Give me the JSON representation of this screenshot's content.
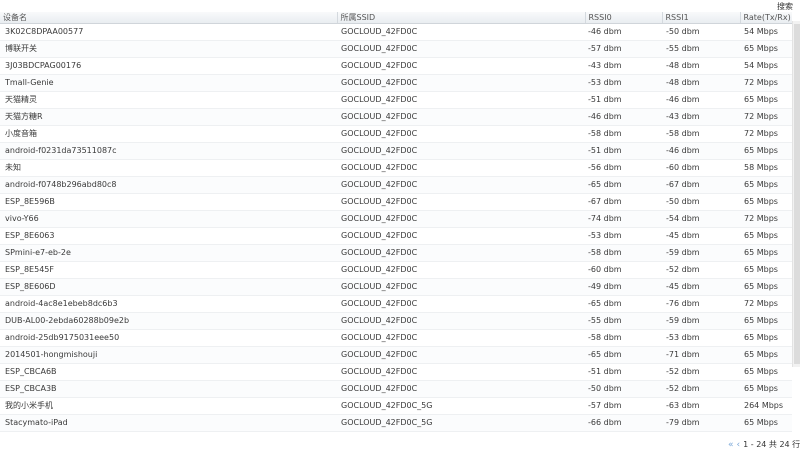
{
  "toolbar": {
    "search_label": "搜索"
  },
  "table": {
    "headers": {
      "device_name": "设备名",
      "ssid": "所属SSID",
      "rssi0": "RSSI0",
      "rssi1": "RSSI1",
      "rate": "Rate(Tx/Rx)"
    },
    "rows": [
      {
        "name": "3K02C8DPAA00577",
        "ssid": "GOCLOUD_42FD0C",
        "rssi0": "-46 dbm",
        "rssi1": "-50 dbm",
        "rate": "54 Mbps"
      },
      {
        "name": "博联开关",
        "ssid": "GOCLOUD_42FD0C",
        "rssi0": "-57 dbm",
        "rssi1": "-55 dbm",
        "rate": "65 Mbps"
      },
      {
        "name": "3J03BDCPAG00176",
        "ssid": "GOCLOUD_42FD0C",
        "rssi0": "-43 dbm",
        "rssi1": "-48 dbm",
        "rate": "54 Mbps"
      },
      {
        "name": "Tmall-Genie",
        "ssid": "GOCLOUD_42FD0C",
        "rssi0": "-53 dbm",
        "rssi1": "-48 dbm",
        "rate": "72 Mbps"
      },
      {
        "name": "天猫精灵",
        "ssid": "GOCLOUD_42FD0C",
        "rssi0": "-51 dbm",
        "rssi1": "-46 dbm",
        "rate": "65 Mbps"
      },
      {
        "name": "天猫方糖R",
        "ssid": "GOCLOUD_42FD0C",
        "rssi0": "-46 dbm",
        "rssi1": "-43 dbm",
        "rate": "72 Mbps"
      },
      {
        "name": "小度音箱",
        "ssid": "GOCLOUD_42FD0C",
        "rssi0": "-58 dbm",
        "rssi1": "-58 dbm",
        "rate": "72 Mbps"
      },
      {
        "name": "android-f0231da73511087c",
        "ssid": "GOCLOUD_42FD0C",
        "rssi0": "-51 dbm",
        "rssi1": "-46 dbm",
        "rate": "65 Mbps"
      },
      {
        "name": "未知",
        "ssid": "GOCLOUD_42FD0C",
        "rssi0": "-56 dbm",
        "rssi1": "-60 dbm",
        "rate": "58 Mbps"
      },
      {
        "name": "android-f0748b296abd80c8",
        "ssid": "GOCLOUD_42FD0C",
        "rssi0": "-65 dbm",
        "rssi1": "-67 dbm",
        "rate": "65 Mbps"
      },
      {
        "name": "ESP_8E596B",
        "ssid": "GOCLOUD_42FD0C",
        "rssi0": "-67 dbm",
        "rssi1": "-50 dbm",
        "rate": "65 Mbps"
      },
      {
        "name": "vivo-Y66",
        "ssid": "GOCLOUD_42FD0C",
        "rssi0": "-74 dbm",
        "rssi1": "-54 dbm",
        "rate": "72 Mbps"
      },
      {
        "name": "ESP_8E6063",
        "ssid": "GOCLOUD_42FD0C",
        "rssi0": "-53 dbm",
        "rssi1": "-45 dbm",
        "rate": "65 Mbps"
      },
      {
        "name": "SPmini-e7-eb-2e",
        "ssid": "GOCLOUD_42FD0C",
        "rssi0": "-58 dbm",
        "rssi1": "-59 dbm",
        "rate": "65 Mbps"
      },
      {
        "name": "ESP_8E545F",
        "ssid": "GOCLOUD_42FD0C",
        "rssi0": "-60 dbm",
        "rssi1": "-52 dbm",
        "rate": "65 Mbps"
      },
      {
        "name": "ESP_8E606D",
        "ssid": "GOCLOUD_42FD0C",
        "rssi0": "-49 dbm",
        "rssi1": "-45 dbm",
        "rate": "65 Mbps"
      },
      {
        "name": "android-4ac8e1ebeb8dc6b3",
        "ssid": "GOCLOUD_42FD0C",
        "rssi0": "-65 dbm",
        "rssi1": "-76 dbm",
        "rate": "72 Mbps"
      },
      {
        "name": "DUB-AL00-2ebda60288b09e2b",
        "ssid": "GOCLOUD_42FD0C",
        "rssi0": "-55 dbm",
        "rssi1": "-59 dbm",
        "rate": "65 Mbps"
      },
      {
        "name": "android-25db9175031eee50",
        "ssid": "GOCLOUD_42FD0C",
        "rssi0": "-58 dbm",
        "rssi1": "-53 dbm",
        "rate": "65 Mbps"
      },
      {
        "name": "2014501-hongmishouji",
        "ssid": "GOCLOUD_42FD0C",
        "rssi0": "-65 dbm",
        "rssi1": "-71 dbm",
        "rate": "65 Mbps"
      },
      {
        "name": "ESP_CBCA6B",
        "ssid": "GOCLOUD_42FD0C",
        "rssi0": "-51 dbm",
        "rssi1": "-52 dbm",
        "rate": "65 Mbps"
      },
      {
        "name": "ESP_CBCA3B",
        "ssid": "GOCLOUD_42FD0C",
        "rssi0": "-50 dbm",
        "rssi1": "-52 dbm",
        "rate": "65 Mbps"
      },
      {
        "name": "我的小米手机",
        "ssid": "GOCLOUD_42FD0C_5G",
        "rssi0": "-57 dbm",
        "rssi1": "-63 dbm",
        "rate": "264 Mbps"
      },
      {
        "name": "Stacymato-iPad",
        "ssid": "GOCLOUD_42FD0C_5G",
        "rssi0": "-66 dbm",
        "rssi1": "-79 dbm",
        "rate": "65 Mbps"
      }
    ]
  },
  "pager": {
    "info": "1 - 24 共 24 行"
  },
  "icons": {
    "first_page": "first-page-icon",
    "prev_page": "prev-page-icon"
  }
}
